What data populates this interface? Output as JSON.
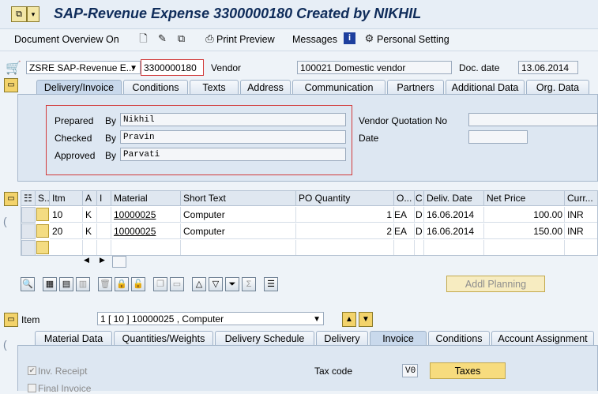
{
  "window": {
    "title": "SAP-Revenue Expense 3300000180 Created by NIKHIL"
  },
  "toolbar": {
    "document_overview": "Document Overview On",
    "print_preview": "Print Preview",
    "messages": "Messages",
    "personal_setting": "Personal Setting"
  },
  "header": {
    "doc_type": "ZSRE SAP-Revenue E...",
    "doc_number": "3300000180",
    "vendor_label": "Vendor",
    "vendor_value": "100021 Domestic vendor",
    "doc_date_label": "Doc. date",
    "doc_date_value": "13.06.2014"
  },
  "header_tabs": [
    "Delivery/Invoice",
    "Conditions",
    "Texts",
    "Address",
    "Communication",
    "Partners",
    "Additional Data",
    "Org. Data"
  ],
  "approval": {
    "prepared_label": "Prepared",
    "checked_label": "Checked",
    "approved_label": "Approved",
    "by_label": "By",
    "prepared_by": "Nikhil",
    "checked_by": "Pravin",
    "approved_by": "Parvati",
    "vendor_quotation_label": "Vendor Quotation No",
    "date_label": "Date"
  },
  "grid": {
    "headers": [
      "S..",
      "Itm",
      "A",
      "I",
      "Material",
      "Short Text",
      "PO Quantity",
      "O...",
      "C",
      "Deliv. Date",
      "Net Price",
      "Curr..."
    ],
    "rows": [
      {
        "itm": "10",
        "a": "K",
        "material": "10000025",
        "short_text": "Computer",
        "qty": "1",
        "uom": "EA",
        "cat": "D",
        "deliv_date": "16.06.2014",
        "net_price": "100.00",
        "curr": "INR"
      },
      {
        "itm": "20",
        "a": "K",
        "material": "10000025",
        "short_text": "Computer",
        "qty": "2",
        "uom": "EA",
        "cat": "D",
        "deliv_date": "16.06.2014",
        "net_price": "150.00",
        "curr": "INR"
      }
    ]
  },
  "buttons": {
    "addl_planning": "Addl Planning",
    "taxes": "Taxes"
  },
  "item": {
    "label": "Item",
    "selected": "1 [ 10 ] 10000025 , Computer"
  },
  "item_tabs": [
    "Material Data",
    "Quantities/Weights",
    "Delivery Schedule",
    "Delivery",
    "Invoice",
    "Conditions",
    "Account Assignment"
  ],
  "invoice": {
    "inv_receipt": "Inv. Receipt",
    "final_invoice": "Final Invoice",
    "tax_code_label": "Tax code",
    "tax_code_value": "V0"
  }
}
